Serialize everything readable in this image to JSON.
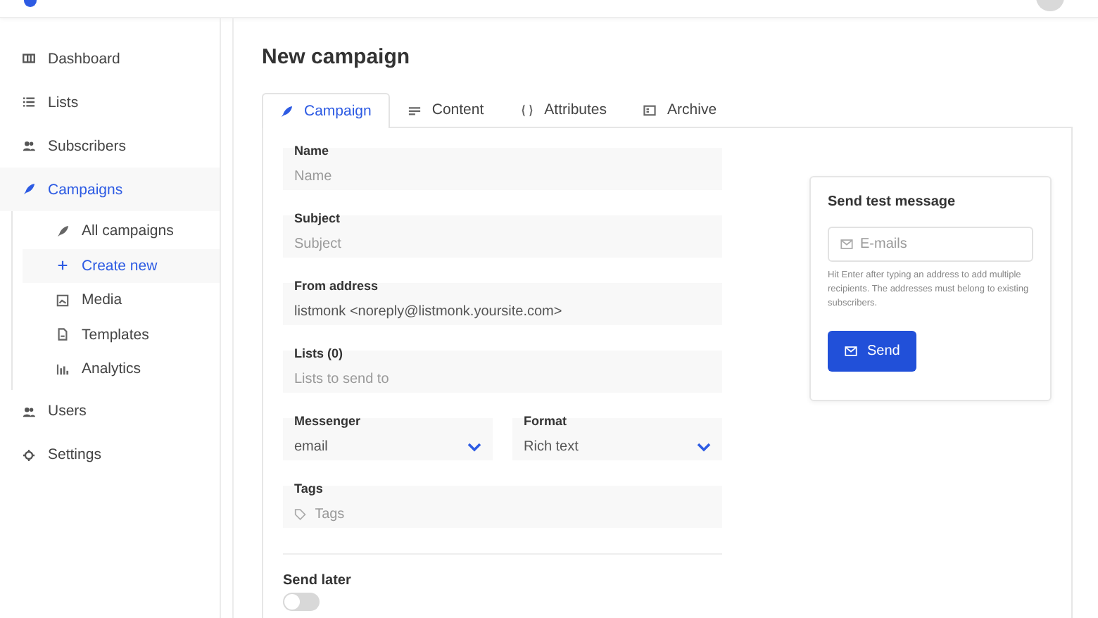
{
  "sidebar": {
    "items": [
      {
        "label": "Dashboard",
        "selected": false
      },
      {
        "label": "Lists",
        "selected": false
      },
      {
        "label": "Subscribers",
        "selected": false
      },
      {
        "label": "Campaigns",
        "selected": true,
        "expanded": true,
        "children": [
          {
            "label": "All campaigns",
            "selected": false
          },
          {
            "label": "Create new",
            "selected": true
          },
          {
            "label": "Media",
            "selected": false
          },
          {
            "label": "Templates",
            "selected": false
          },
          {
            "label": "Analytics",
            "selected": false
          }
        ]
      },
      {
        "label": "Users",
        "selected": false
      },
      {
        "label": "Settings",
        "selected": false
      }
    ]
  },
  "page": {
    "title": "New campaign"
  },
  "tabs": [
    {
      "label": "Campaign",
      "selected": true
    },
    {
      "label": "Content",
      "selected": false
    },
    {
      "label": "Attributes",
      "selected": false
    },
    {
      "label": "Archive",
      "selected": false
    }
  ],
  "form": {
    "rows": [
      {
        "fields": [
          {
            "kind": "text",
            "label": "Name",
            "placeholder": "Name"
          }
        ]
      },
      {
        "fields": [
          {
            "kind": "text",
            "label": "Subject",
            "placeholder": "Subject"
          }
        ]
      },
      {
        "fields": [
          {
            "kind": "text",
            "label": "From address",
            "value": "listmonk <noreply@listmonk.yoursite.com>"
          }
        ]
      },
      {
        "fields": [
          {
            "kind": "text",
            "label": "Lists (0)",
            "placeholder": "Lists to send to"
          }
        ]
      },
      {
        "fields": [
          {
            "kind": "select",
            "label": "Messenger",
            "value": "email"
          },
          {
            "kind": "select",
            "label": "Format",
            "value": "Rich text"
          }
        ]
      },
      {
        "fields": [
          {
            "kind": "tags",
            "label": "Tags",
            "placeholder": "Tags"
          }
        ]
      }
    ],
    "send_later": {
      "label": "Send later",
      "on": false
    }
  },
  "test_message": {
    "title": "Send test message",
    "placeholder": "E-mails",
    "help": "Hit Enter after typing an address to add multiple recipients. The addresses must belong to existing subscribers.",
    "button": "Send"
  }
}
